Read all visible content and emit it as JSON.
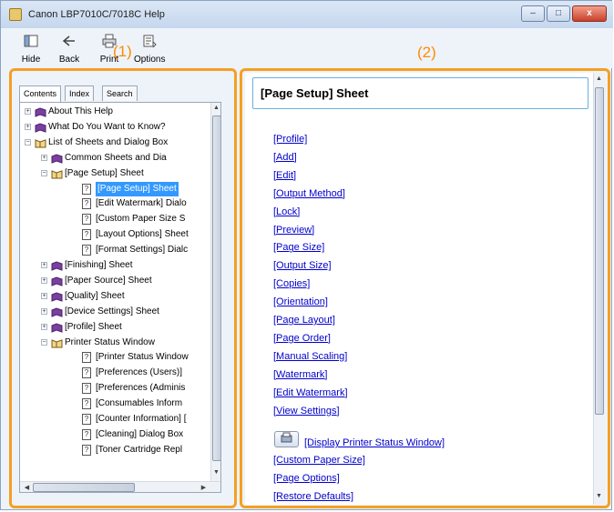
{
  "window": {
    "title": "Canon LBP7010C/7018C Help"
  },
  "window_controls": {
    "minimize": "–",
    "maximize": "□",
    "close": "x"
  },
  "toolbar": [
    {
      "icon": "hide-icon",
      "label": "Hide"
    },
    {
      "icon": "back-icon",
      "label": "Back"
    },
    {
      "icon": "print-icon",
      "label": "Print"
    },
    {
      "icon": "options-icon",
      "label": "Options"
    }
  ],
  "callouts": {
    "left": "(1)",
    "right": "(2)"
  },
  "nav_tabs": [
    {
      "label": "Contents",
      "active": true
    },
    {
      "label": "Index",
      "active": false
    },
    {
      "label": "Search",
      "active": false
    }
  ],
  "tree": [
    {
      "label": "About This Help",
      "level": 0,
      "type": "book",
      "expander": "+"
    },
    {
      "label": "What Do You Want to Know?",
      "level": 0,
      "type": "book",
      "expander": "+"
    },
    {
      "label": "List of Sheets and Dialog Box",
      "level": 0,
      "type": "open-book",
      "expander": "−"
    },
    {
      "label": "Common Sheets and Dia",
      "level": 1,
      "type": "book",
      "expander": "+"
    },
    {
      "label": "[Page Setup] Sheet",
      "level": 1,
      "type": "open-book",
      "expander": "−"
    },
    {
      "label": "[Page Setup] Sheet",
      "level": 2,
      "type": "page",
      "selected": true
    },
    {
      "label": "[Edit Watermark] Dialo",
      "level": 2,
      "type": "page"
    },
    {
      "label": "[Custom Paper Size S",
      "level": 2,
      "type": "page"
    },
    {
      "label": "[Layout Options] Sheet",
      "level": 2,
      "type": "page"
    },
    {
      "label": "[Format Settings] Dialc",
      "level": 2,
      "type": "page"
    },
    {
      "label": "[Finishing] Sheet",
      "level": 1,
      "type": "book",
      "expander": "+"
    },
    {
      "label": "[Paper Source] Sheet",
      "level": 1,
      "type": "book",
      "expander": "+"
    },
    {
      "label": "[Quality] Sheet",
      "level": 1,
      "type": "book",
      "expander": "+"
    },
    {
      "label": "[Device Settings] Sheet",
      "level": 1,
      "type": "book",
      "expander": "+"
    },
    {
      "label": "[Profile] Sheet",
      "level": 1,
      "type": "book",
      "expander": "+"
    },
    {
      "label": "Printer Status Window",
      "level": 1,
      "type": "open-book",
      "expander": "−"
    },
    {
      "label": "[Printer Status Window",
      "level": 2,
      "type": "page"
    },
    {
      "label": "[Preferences (Users)]",
      "level": 2,
      "type": "page"
    },
    {
      "label": "[Preferences (Adminis",
      "level": 2,
      "type": "page"
    },
    {
      "label": "[Consumables Inform",
      "level": 2,
      "type": "page"
    },
    {
      "label": "[Counter Information] [",
      "level": 2,
      "type": "page"
    },
    {
      "label": "[Cleaning] Dialog Box",
      "level": 2,
      "type": "page"
    },
    {
      "label": "[Toner Cartridge Repl",
      "level": 2,
      "type": "page"
    }
  ],
  "content": {
    "heading": "[Page Setup] Sheet",
    "links": [
      "[Profile]",
      "[Add]",
      "[Edit]",
      "[Output Method]",
      "[Lock]",
      "[Preview]",
      "[Page Size]",
      "[Output Size]",
      "[Copies]",
      "[Orientation]",
      "[Page Layout]",
      "[Page Order]",
      "[Manual Scaling]",
      "[Watermark]",
      "[Edit Watermark]",
      "[View Settings]"
    ],
    "button_link": "[Display Printer Status Window]",
    "links_after": [
      "[Custom Paper Size]",
      "[Page Options]",
      "[Restore Defaults]"
    ]
  },
  "colors": {
    "callout": "#ff8a00",
    "frame": "#f5a023",
    "link": "#0000cc",
    "selection": "#3399ff"
  }
}
